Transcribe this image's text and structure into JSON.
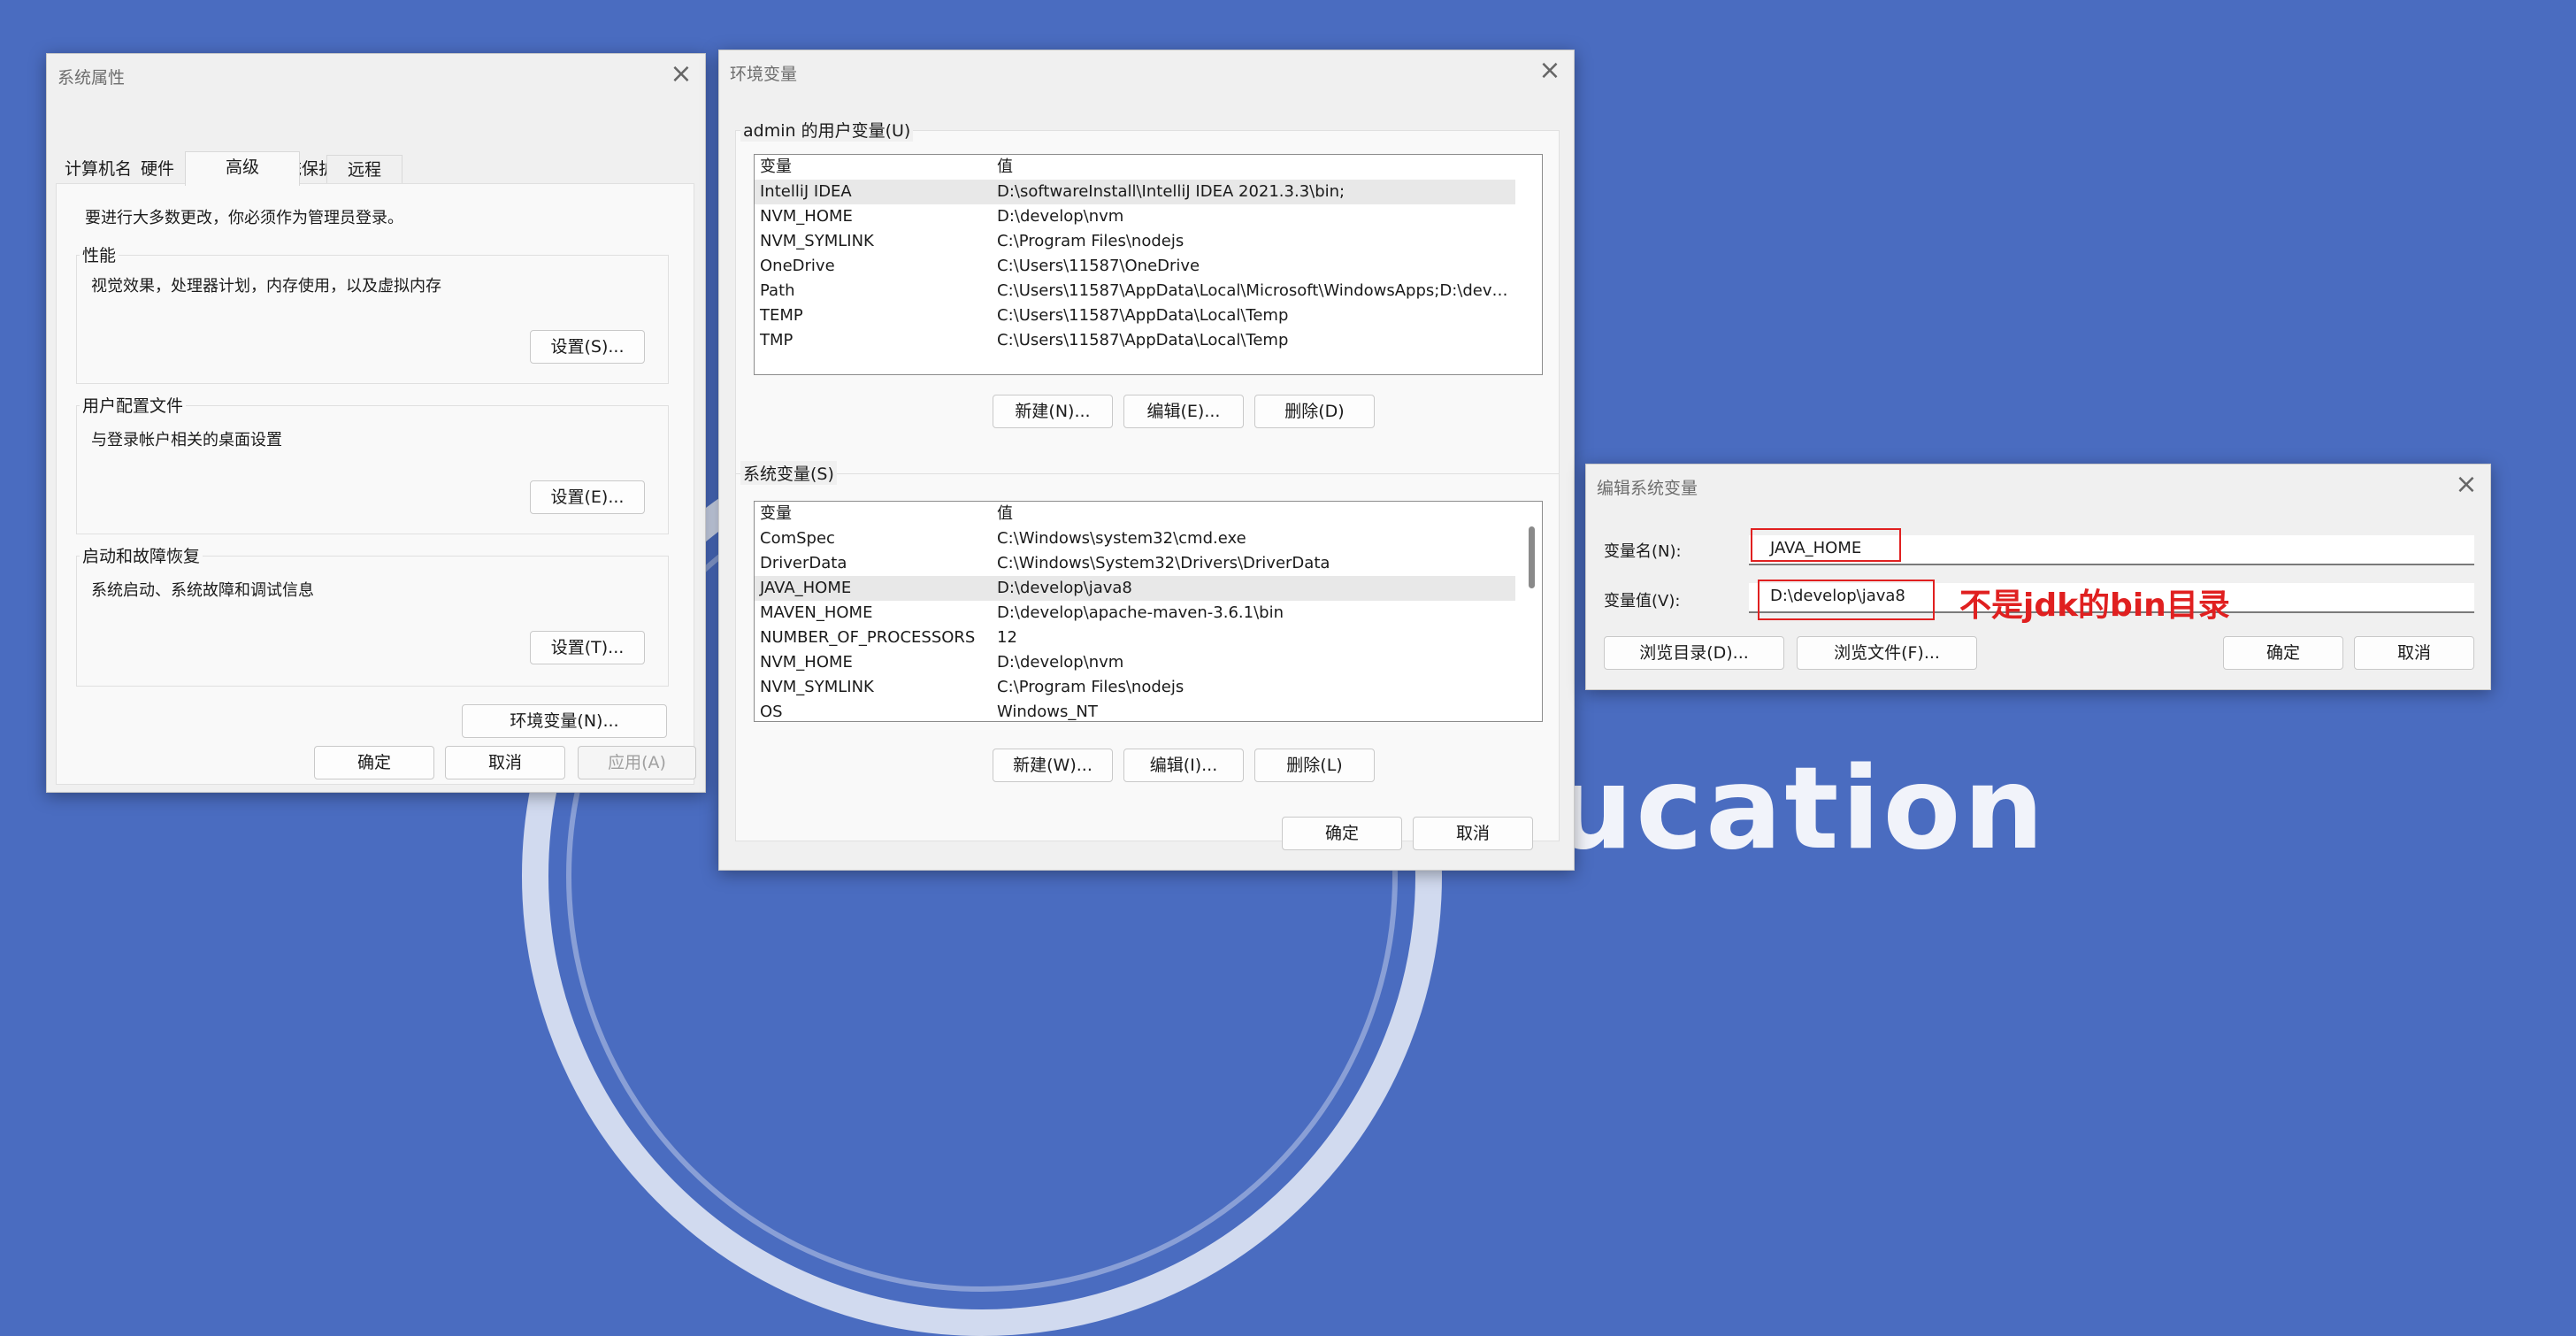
{
  "background": {
    "text": "ucation"
  },
  "system_properties": {
    "title": "系统属性",
    "tabs": [
      {
        "label": "计算机名"
      },
      {
        "label": "硬件"
      },
      {
        "label": "高级"
      },
      {
        "label": "系统保护"
      },
      {
        "label": "远程"
      }
    ],
    "admin_note": "要进行大多数更改，你必须作为管理员登录。",
    "performance": {
      "label": "性能",
      "desc": "视觉效果，处理器计划，内存使用，以及虚拟内存",
      "button": "设置(S)..."
    },
    "user_profiles": {
      "label": "用户配置文件",
      "desc": "与登录帐户相关的桌面设置",
      "button": "设置(E)..."
    },
    "startup": {
      "label": "启动和故障恢复",
      "desc": "系统启动、系统故障和调试信息",
      "button": "设置(T)..."
    },
    "env_button": "环境变量(N)...",
    "ok": "确定",
    "cancel": "取消",
    "apply": "应用(A)"
  },
  "env_vars": {
    "title": "环境变量",
    "user_section_label": "admin 的用户变量(U)",
    "col_name": "变量",
    "col_value": "值",
    "user_vars": [
      {
        "name": "IntelliJ IDEA",
        "value": "D:\\softwareInstall\\IntelliJ IDEA 2021.3.3\\bin;"
      },
      {
        "name": "NVM_HOME",
        "value": "D:\\develop\\nvm"
      },
      {
        "name": "NVM_SYMLINK",
        "value": "C:\\Program Files\\nodejs"
      },
      {
        "name": "OneDrive",
        "value": "C:\\Users\\11587\\OneDrive"
      },
      {
        "name": "Path",
        "value": "C:\\Users\\11587\\AppData\\Local\\Microsoft\\WindowsApps;D:\\devel..."
      },
      {
        "name": "TEMP",
        "value": "C:\\Users\\11587\\AppData\\Local\\Temp"
      },
      {
        "name": "TMP",
        "value": "C:\\Users\\11587\\AppData\\Local\\Temp"
      }
    ],
    "user_buttons": {
      "new": "新建(N)...",
      "edit": "编辑(E)...",
      "delete": "删除(D)"
    },
    "system_section_label": "系统变量(S)",
    "system_vars": [
      {
        "name": "ComSpec",
        "value": "C:\\Windows\\system32\\cmd.exe"
      },
      {
        "name": "DriverData",
        "value": "C:\\Windows\\System32\\Drivers\\DriverData"
      },
      {
        "name": "JAVA_HOME",
        "value": "D:\\develop\\java8"
      },
      {
        "name": "MAVEN_HOME",
        "value": "D:\\develop\\apache-maven-3.6.1\\bin"
      },
      {
        "name": "NUMBER_OF_PROCESSORS",
        "value": "12"
      },
      {
        "name": "NVM_HOME",
        "value": "D:\\develop\\nvm"
      },
      {
        "name": "NVM_SYMLINK",
        "value": "C:\\Program Files\\nodejs"
      },
      {
        "name": "OS",
        "value": "Windows_NT"
      }
    ],
    "system_buttons": {
      "new": "新建(W)...",
      "edit": "编辑(I)...",
      "delete": "删除(L)"
    },
    "ok": "确定",
    "cancel": "取消"
  },
  "edit_system_var": {
    "title": "编辑系统变量",
    "name_label": "变量名(N):",
    "name_value": "JAVA_HOME",
    "value_label": "变量值(V):",
    "value_value": "D:\\develop\\java8",
    "annotation": "不是jdk的bin目录",
    "browse_dir": "浏览目录(D)...",
    "browse_file": "浏览文件(F)...",
    "ok": "确定",
    "cancel": "取消"
  },
  "colors": {
    "background": "#4a6cc0",
    "annotation_red": "#e02020"
  }
}
